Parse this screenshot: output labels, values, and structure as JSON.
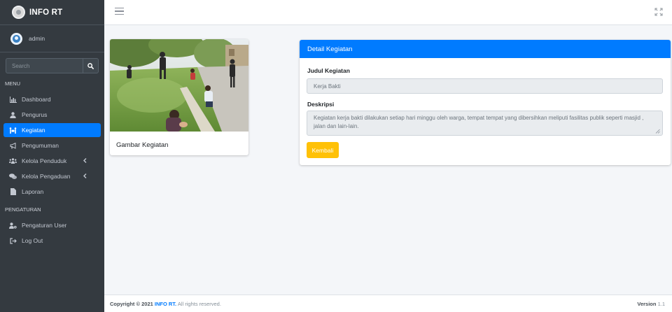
{
  "brand": {
    "name": "INFO RT"
  },
  "user": {
    "name": "admin"
  },
  "search": {
    "placeholder": "Search"
  },
  "sidebar": {
    "menu_header": "MENU",
    "items": [
      {
        "label": "Dashboard",
        "icon": "chart-icon"
      },
      {
        "label": "Pengurus",
        "icon": "user-icon"
      },
      {
        "label": "Kegiatan",
        "icon": "people-carry-icon",
        "active": true
      },
      {
        "label": "Pengumuman",
        "icon": "bullhorn-icon"
      },
      {
        "label": "Kelola Penduduk",
        "icon": "users-icon",
        "has_submenu": true
      },
      {
        "label": "Kelola Pengaduan",
        "icon": "comments-icon",
        "has_submenu": true
      },
      {
        "label": "Laporan",
        "icon": "file-icon"
      }
    ],
    "settings_header": "PENGATURAN",
    "settings_items": [
      {
        "label": "Pengaturan User",
        "icon": "user-cog-icon"
      },
      {
        "label": "Log Out",
        "icon": "sign-out-icon"
      }
    ]
  },
  "image_card": {
    "caption": "Gambar Kegiatan"
  },
  "detail": {
    "header": "Detail Kegiatan",
    "judul_label": "Judul Kegiatan",
    "judul_value": "Kerja Bakti",
    "deskripsi_label": "Deskripsi",
    "deskripsi_value": "Kegiatan kerja bakti dilakukan setiap hari minggu oleh warga, tempat tempat yang dibersihkan meliputi fasilitas publik seperti masjid , jalan dan lain-lain.",
    "back_button": "Kembali"
  },
  "footer": {
    "copyright_prefix": "Copyright © 2021",
    "brand_link": "INFO RT.",
    "rights": "All rights reserved.",
    "version_label": "Version",
    "version_number": "1.1"
  },
  "colors": {
    "sidebar_bg": "#343a40",
    "active_item": "#007bff",
    "card_header": "#007bff",
    "back_button": "#ffc107",
    "content_bg": "#f4f6f9"
  }
}
